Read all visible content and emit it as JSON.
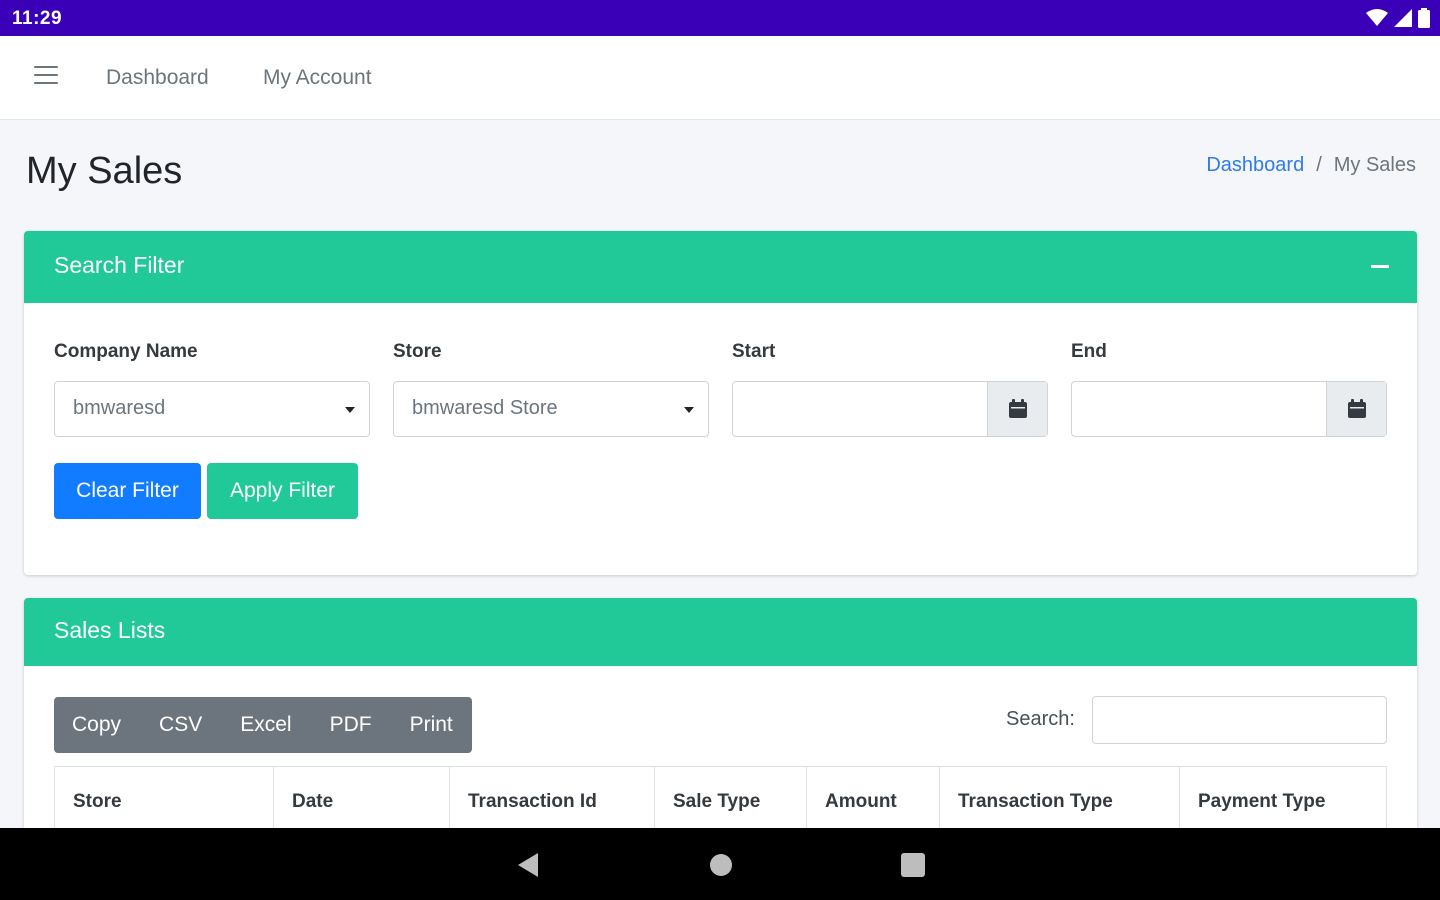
{
  "status_bar": {
    "time": "11:29",
    "icons": [
      "wifi-icon",
      "signal-icon",
      "battery-icon"
    ]
  },
  "top_nav": {
    "menu_icon": "hamburger-icon",
    "links": [
      "Dashboard",
      "My Account"
    ]
  },
  "page": {
    "title": "My Sales",
    "breadcrumb": {
      "home": "Dashboard",
      "separator": "/",
      "current": "My Sales"
    }
  },
  "search_filter": {
    "title": "Search Filter",
    "collapse_icon": "minus-icon",
    "fields": {
      "company": {
        "label": "Company Name",
        "value": "bmwaresd"
      },
      "store": {
        "label": "Store",
        "value": "bmwaresd Store"
      },
      "start": {
        "label": "Start",
        "value": "",
        "icon": "calendar-icon"
      },
      "end": {
        "label": "End",
        "value": "",
        "icon": "calendar-icon"
      }
    },
    "buttons": {
      "clear": "Clear Filter",
      "apply": "Apply Filter"
    }
  },
  "sales_lists": {
    "title": "Sales Lists",
    "export_buttons": [
      "Copy",
      "CSV",
      "Excel",
      "PDF",
      "Print"
    ],
    "search_label": "Search:",
    "search_value": "",
    "columns": [
      "Store",
      "Date",
      "Transaction Id",
      "Sale Type",
      "Amount",
      "Transaction Type",
      "Payment Type"
    ]
  },
  "colors": {
    "accent": "#20c997",
    "primary": "#117cff",
    "status_bar": "#3a00b8",
    "secondary": "#6c757d"
  },
  "android_nav": [
    "back-icon",
    "home-icon",
    "recents-icon"
  ]
}
